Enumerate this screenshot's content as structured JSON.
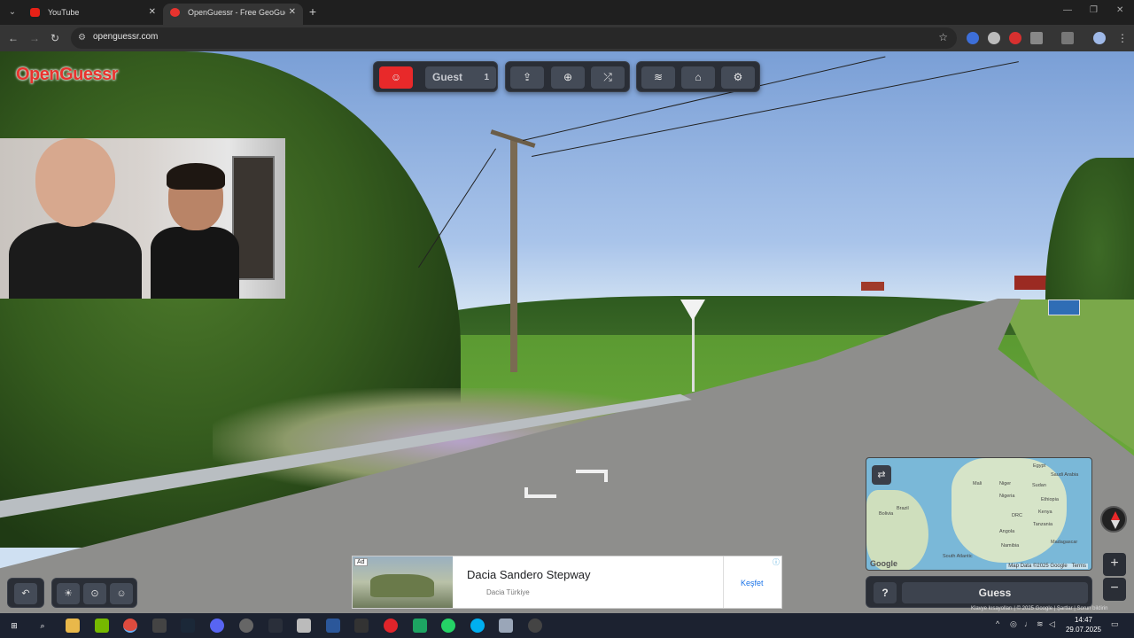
{
  "browser": {
    "tabs": [
      {
        "title": "YouTube",
        "active": false
      },
      {
        "title": "OpenGuessr - Free GeoGuessr Alternative",
        "active": true
      }
    ],
    "url": "openguessr.com"
  },
  "app": {
    "logo": "OpenGuessr",
    "toolbar": {
      "guest_name": "Guest",
      "guest_count": "1"
    },
    "minimap": {
      "labels": {
        "egypt": "Egypt",
        "mali": "Mali",
        "niger": "Niger",
        "sudan": "Sudan",
        "nigeria": "Nigeria",
        "ethiopia": "Ethiopia",
        "saudi": "Saudi Arabia",
        "drc": "DRC",
        "kenya": "Kenya",
        "tanzania": "Tanzania",
        "angola": "Angola",
        "brazil": "Brazil",
        "south_atlantic": "South Atlantic",
        "bolivia": "Bolivia",
        "madagascar": "Madagascar",
        "namibia": "Namibia"
      },
      "google": "Google",
      "attribution": "Map Data ©2025 Google",
      "terms": "Terms"
    },
    "guess": {
      "help": "?",
      "label": "Guess"
    },
    "footer": "Klavye kısayolları | © 2025 Google | Şartlar | Sorun bildirin"
  },
  "ad": {
    "tag": "Ad",
    "title": "Dacia Sandero Stepway",
    "advertiser": "Dacia Türkiye",
    "cta": "Keşfet",
    "info": "ⓘ"
  },
  "taskbar": {
    "time": "14:47",
    "date": "29.07.2025"
  },
  "colors": {
    "brand_red": "#e8332e",
    "panel": "#2a2e36",
    "button": "#444b57"
  }
}
